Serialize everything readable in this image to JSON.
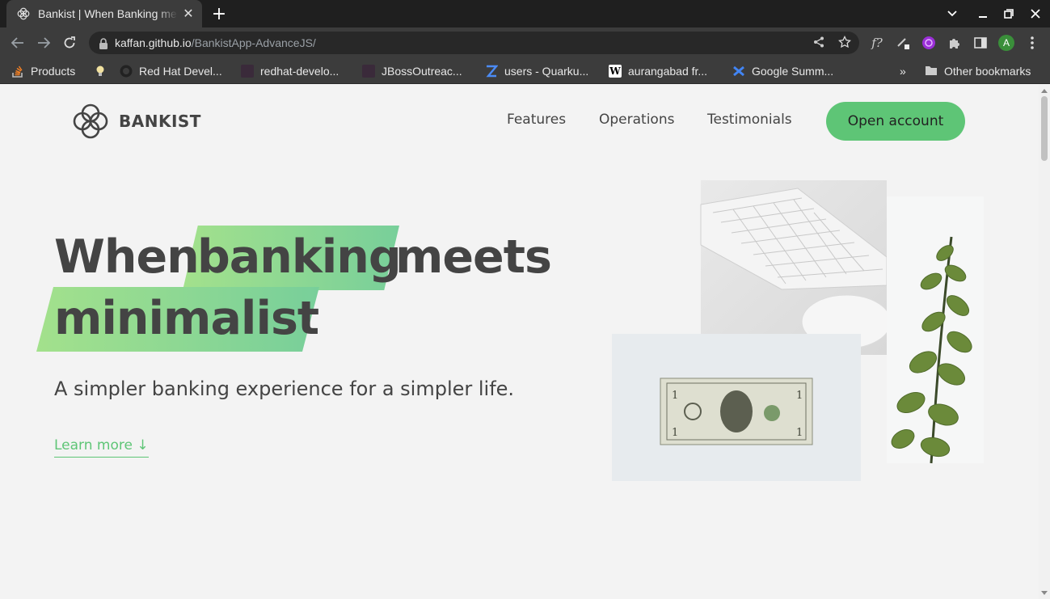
{
  "browser": {
    "tab_title": "Bankist | When Banking meets minimalist",
    "url_host": "kaffan.github.io",
    "url_path": "/BankistApp-AdvanceJS/",
    "profile_initial": "A",
    "bookmarks": [
      {
        "label": "Products",
        "color": "#f48024"
      },
      {
        "label": "",
        "color": "#f2e2a0"
      },
      {
        "label": "Red Hat Devel...",
        "color": "#222222"
      },
      {
        "label": "redhat-develo...",
        "color": "#3a2a3a"
      },
      {
        "label": "JBossOutreac...",
        "color": "#3a2a3a"
      },
      {
        "label": "users - Quarku...",
        "color": "#4b8bf5"
      },
      {
        "label": "aurangabad fr...",
        "color": "#ffffff"
      },
      {
        "label": "Google Summ...",
        "color": "#4285f4"
      }
    ],
    "other_bookmarks": "Other bookmarks"
  },
  "page": {
    "logo_text": "BANKIST",
    "nav": [
      "Features",
      "Operations",
      "Testimonials"
    ],
    "cta": "Open account",
    "headline": {
      "word1": "When",
      "word2": "banking",
      "word3": "meets",
      "word4": "minimalist"
    },
    "subtitle": "A simpler banking experience for a simpler life.",
    "learn_more": "Learn more ↓"
  },
  "colors": {
    "accent": "#5ec576",
    "highlight_start": "#a3e18c",
    "highlight_end": "#78cf9a",
    "text": "#444444"
  }
}
